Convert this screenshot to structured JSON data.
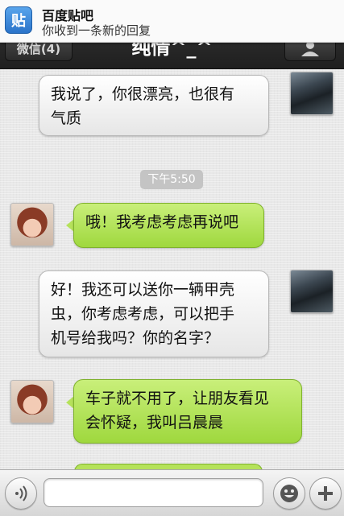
{
  "notification": {
    "app_name": "百度贴吧",
    "message": "你收到一条新的回复",
    "icon_text": "贴"
  },
  "navbar": {
    "back_label": "微信(4)",
    "title": "纯情^_^"
  },
  "messages": [
    {
      "sender": "me",
      "text_lines": [
        "我说了，你很漂亮，也很有",
        "气质"
      ]
    },
    {
      "sender": "her",
      "text_lines": [
        "哦！我考虑考虑再说吧"
      ]
    },
    {
      "sender": "me",
      "text_lines": [
        "好！我还可以送你一辆甲壳",
        "虫，你考虑考虑，可以把手",
        "机号给我吗？你的名字？"
      ]
    },
    {
      "sender": "her",
      "text_lines": [
        "车子就不用了，让朋友看见",
        "会怀疑，我叫吕晨晨"
      ]
    }
  ],
  "timestamp": "下午5:50",
  "input": {
    "value": "",
    "placeholder": ""
  },
  "colors": {
    "incoming_bubble": "#b5e25a",
    "outgoing_bubble": "#f2f2f2",
    "navbar": "#2a2a2a"
  }
}
